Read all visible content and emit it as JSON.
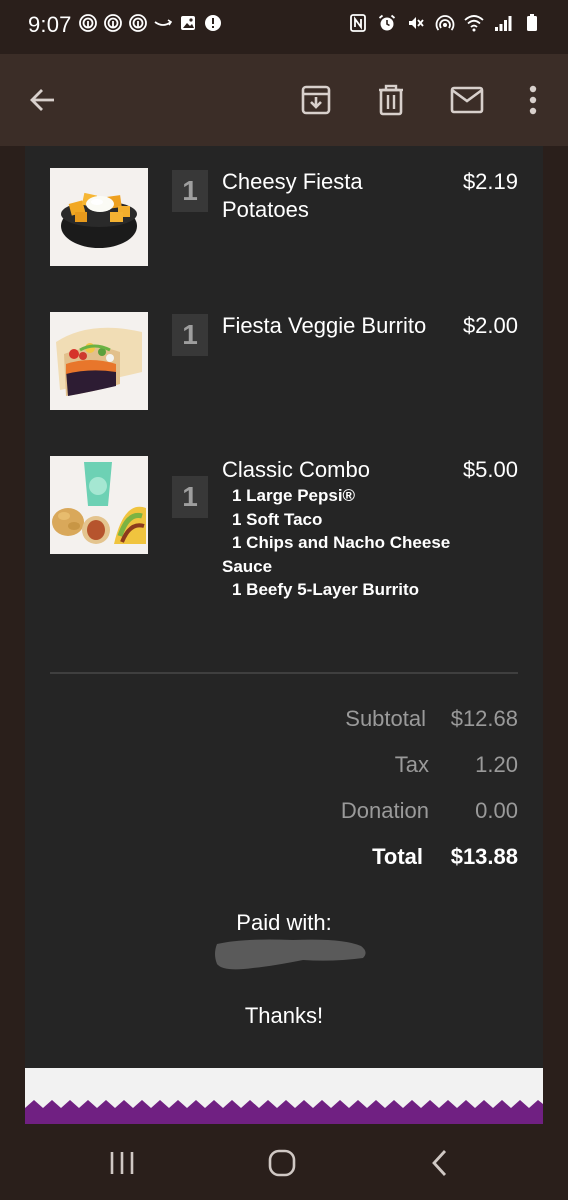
{
  "status_bar": {
    "time": "9:07"
  },
  "app_bar": {
    "back_icon": "arrow-left-icon",
    "archive_icon": "archive-icon",
    "delete_icon": "trash-icon",
    "mark_unread_icon": "mail-icon",
    "more_icon": "more-vert-icon"
  },
  "order": {
    "items": [
      {
        "qty": "1",
        "name_line1": "Cheesy Fiesta",
        "name_line2": "Potatoes",
        "price": "$2.19"
      },
      {
        "qty": "1",
        "name_line1": "Fiesta Veggie Burrito",
        "price": "$2.00"
      },
      {
        "qty": "1",
        "name_line1": "Classic Combo",
        "price": "$5.00",
        "parts": [
          "1 Large Pepsi®",
          "1 Soft Taco",
          "1 Chips and Nacho Cheese",
          "Sauce",
          "1 Beefy 5-Layer Burrito"
        ]
      }
    ]
  },
  "summary": {
    "subtotal_label": "Subtotal",
    "subtotal_value": "$12.68",
    "tax_label": "Tax",
    "tax_value": "1.20",
    "donation_label": "Donation",
    "donation_value": "0.00",
    "total_label": "Total",
    "total_value": "$13.88"
  },
  "payment": {
    "paid_with_label": "Paid with:",
    "thanks": "Thanks!"
  },
  "colors": {
    "background": "#2a1f1b",
    "app_bar": "#3b2d27",
    "card": "#252525",
    "brand_purple": "#702082"
  }
}
